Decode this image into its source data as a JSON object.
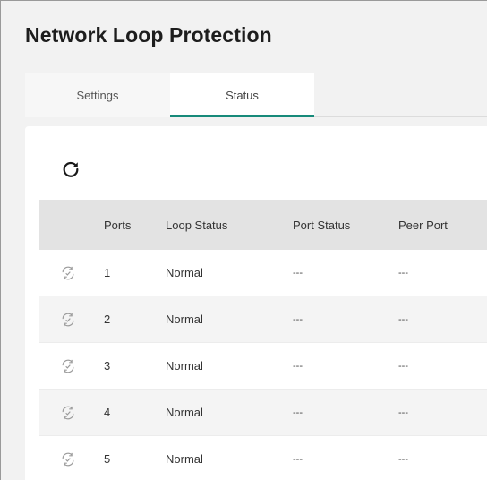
{
  "page": {
    "title": "Network Loop Protection"
  },
  "tabs": [
    {
      "label": "Settings",
      "active": false
    },
    {
      "label": "Status",
      "active": true
    }
  ],
  "toolbar": {
    "refresh_icon": "refresh-icon"
  },
  "colors": {
    "accent": "#178a7a",
    "header_bg": "#e3e3e3"
  },
  "table": {
    "headers": {
      "icon": "",
      "ports": "Ports",
      "loop_status": "Loop Status",
      "port_status": "Port Status",
      "peer_port": "Peer Port"
    },
    "rows": [
      {
        "port": "1",
        "loop_status": "Normal",
        "port_status": "---",
        "peer_port": "---"
      },
      {
        "port": "2",
        "loop_status": "Normal",
        "port_status": "---",
        "peer_port": "---"
      },
      {
        "port": "3",
        "loop_status": "Normal",
        "port_status": "---",
        "peer_port": "---"
      },
      {
        "port": "4",
        "loop_status": "Normal",
        "port_status": "---",
        "peer_port": "---"
      },
      {
        "port": "5",
        "loop_status": "Normal",
        "port_status": "---",
        "peer_port": "---"
      }
    ]
  }
}
